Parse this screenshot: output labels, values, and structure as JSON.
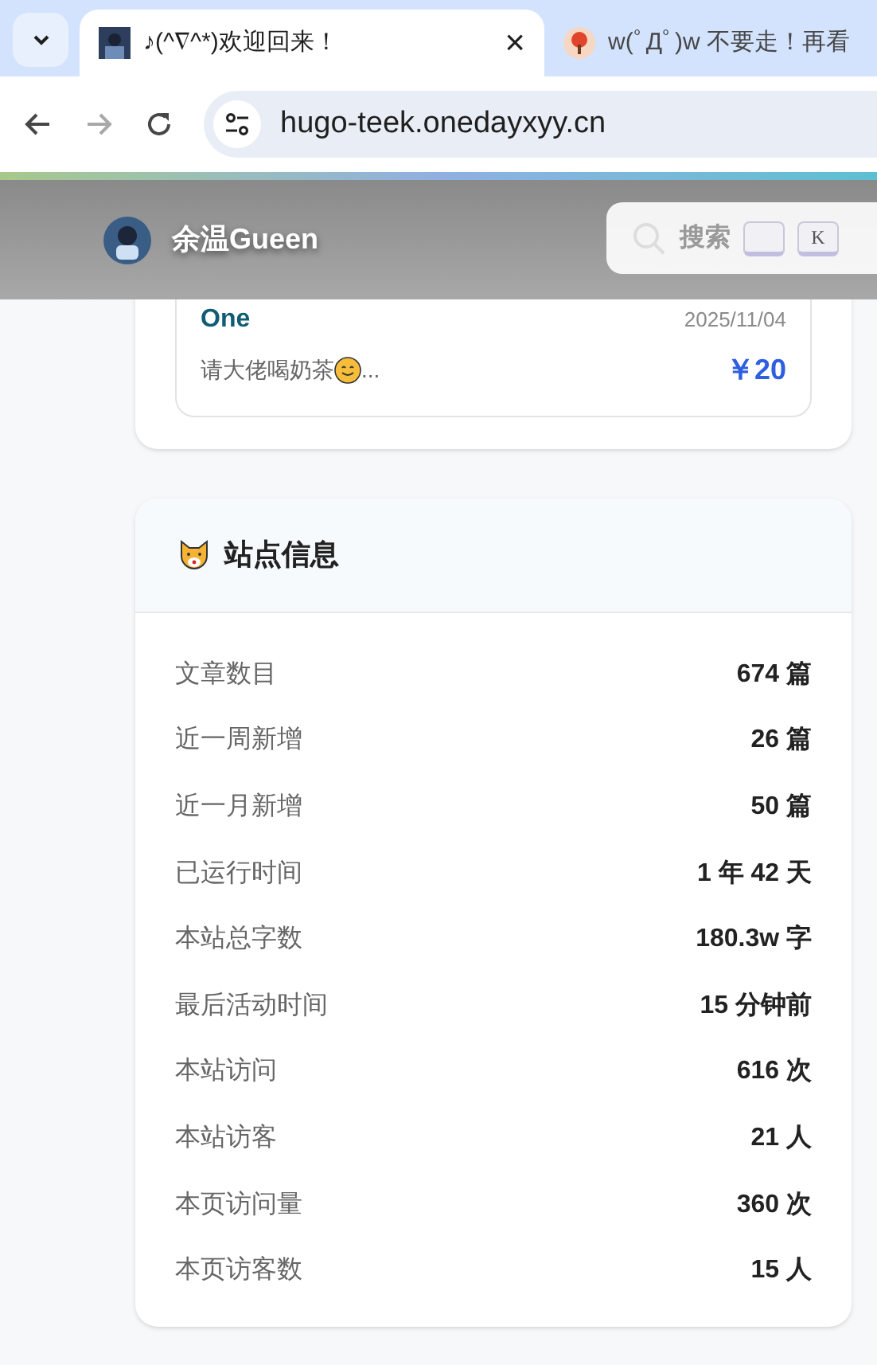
{
  "browser": {
    "tabs": [
      {
        "title": "♪(^∇^*)欢迎回来！",
        "selected": true,
        "close": "×"
      },
      {
        "title": "w(ﾟДﾟ)w 不要走！再看",
        "selected": false
      }
    ],
    "url": "hugo-teek.onedayxyy.cn"
  },
  "header": {
    "site_name": "余温Gueen",
    "search": {
      "placeholder": "搜索",
      "keys": [
        {
          "kind": "blank"
        },
        {
          "kind": "letter",
          "label": "K"
        }
      ]
    }
  },
  "donation": {
    "name": "One",
    "date": "2025/11/04",
    "message": "请大佬喝奶茶",
    "ellipsis": "...",
    "amount": "￥20"
  },
  "site_info": {
    "title": "站点信息",
    "rows": [
      {
        "label": "文章数目",
        "value": "674 篇"
      },
      {
        "label": "近一周新增",
        "value": "26 篇"
      },
      {
        "label": "近一月新增",
        "value": "50 篇"
      },
      {
        "label": "已运行时间",
        "value": "1 年 42 天"
      },
      {
        "label": "本站总字数",
        "value": "180.3w 字"
      },
      {
        "label": "最后活动时间",
        "value": "15 分钟前"
      },
      {
        "label": "本站访问",
        "value": "616 次"
      },
      {
        "label": "本站访客",
        "value": "21 人"
      },
      {
        "label": "本页访问量",
        "value": "360 次"
      },
      {
        "label": "本页访客数",
        "value": "15 人"
      }
    ]
  }
}
